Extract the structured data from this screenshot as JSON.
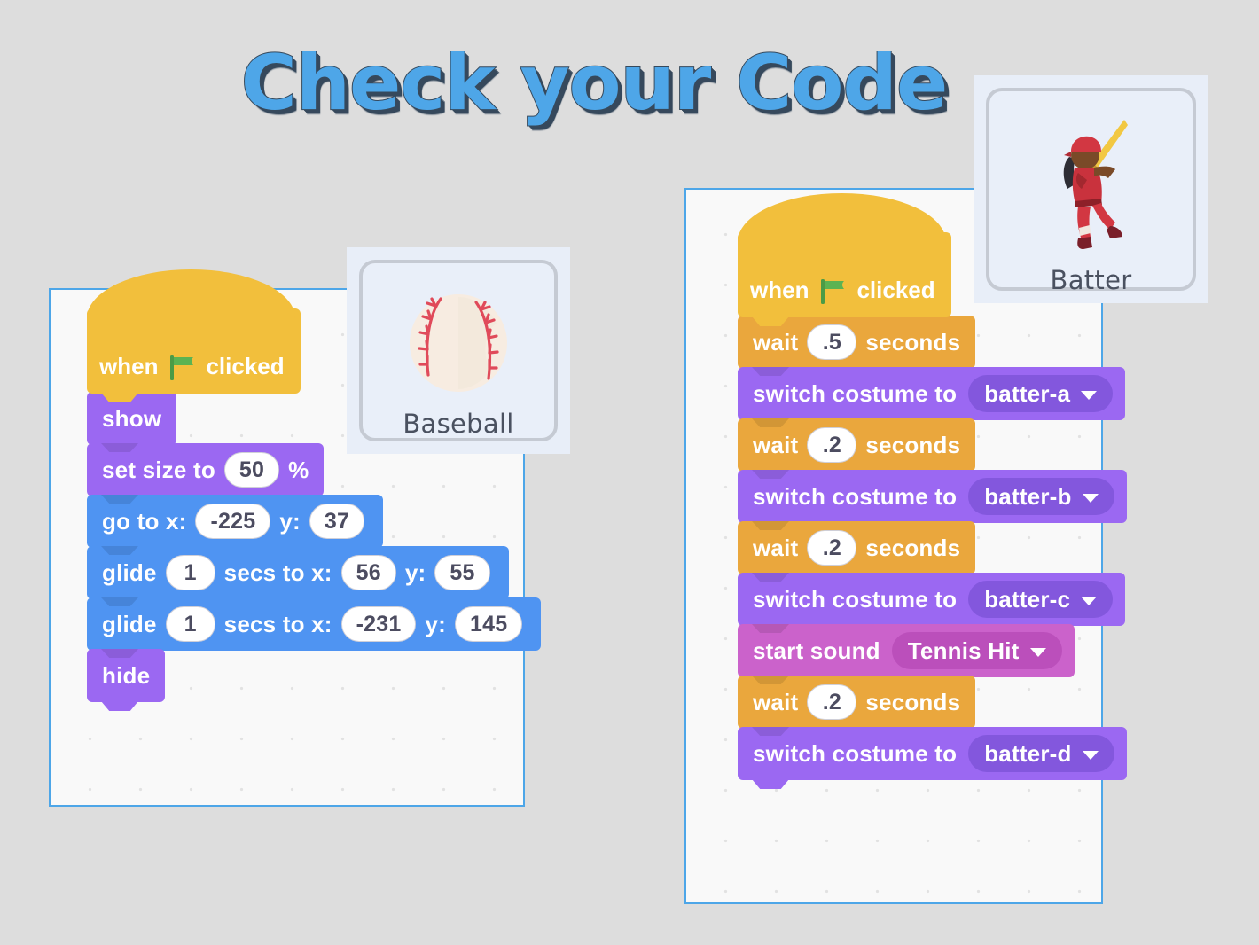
{
  "page": {
    "title": "Check your Code",
    "background_color": "#dddddd",
    "title_color": "#4ea6e8",
    "title_shadow_color": "#36495c"
  },
  "palette_colors": {
    "events": "#f2bf3c",
    "looks": "#9b68f2",
    "motion": "#4f94f2",
    "control": "#eaa73d",
    "sound": "#cb62cb",
    "panel_border": "#4da6e8",
    "panel_background": "#f9f9f9"
  },
  "sprites": [
    {
      "name": "Baseball",
      "icon": "baseball-icon"
    },
    {
      "name": "Batter",
      "icon": "batter-icon"
    }
  ],
  "scripts": [
    {
      "sprite": "Baseball",
      "blocks": [
        {
          "type": "hat",
          "category": "events",
          "words": [
            "when",
            "green-flag-icon",
            "clicked"
          ]
        },
        {
          "type": "stack",
          "category": "looks",
          "label": "show"
        },
        {
          "type": "stack",
          "category": "looks",
          "label_before": "set size to",
          "value": "50",
          "label_after": "%"
        },
        {
          "type": "stack",
          "category": "motion",
          "label_before": "go to x:",
          "value_x": "-225",
          "label_mid": "y:",
          "value_y": "37"
        },
        {
          "type": "stack",
          "category": "motion",
          "label_before": "glide",
          "value_secs": "1",
          "label_mid1": "secs to x:",
          "value_x": "56",
          "label_mid2": "y:",
          "value_y": "55"
        },
        {
          "type": "stack",
          "category": "motion",
          "label_before": "glide",
          "value_secs": "1",
          "label_mid1": "secs to x:",
          "value_x": "-231",
          "label_mid2": "y:",
          "value_y": "145"
        },
        {
          "type": "stack",
          "category": "looks",
          "label": "hide"
        }
      ]
    },
    {
      "sprite": "Batter",
      "blocks": [
        {
          "type": "hat",
          "category": "events",
          "words": [
            "when",
            "green-flag-icon",
            "clicked"
          ]
        },
        {
          "type": "stack",
          "category": "control",
          "label_before": "wait",
          "value": ".5",
          "label_after": "seconds"
        },
        {
          "type": "stack",
          "category": "looks",
          "label_before": "switch costume to",
          "dropdown": "batter-a"
        },
        {
          "type": "stack",
          "category": "control",
          "label_before": "wait",
          "value": ".2",
          "label_after": "seconds"
        },
        {
          "type": "stack",
          "category": "looks",
          "label_before": "switch costume to",
          "dropdown": "batter-b"
        },
        {
          "type": "stack",
          "category": "control",
          "label_before": "wait",
          "value": ".2",
          "label_after": "seconds"
        },
        {
          "type": "stack",
          "category": "looks",
          "label_before": "switch costume to",
          "dropdown": "batter-c"
        },
        {
          "type": "stack",
          "category": "sound",
          "label_before": "start sound",
          "dropdown": "Tennis Hit"
        },
        {
          "type": "stack",
          "category": "control",
          "label_before": "wait",
          "value": ".2",
          "label_after": "seconds"
        },
        {
          "type": "stack",
          "category": "looks",
          "label_before": "switch costume to",
          "dropdown": "batter-d"
        }
      ]
    }
  ],
  "baseball_script": {
    "hat_when": "when",
    "hat_clicked": "clicked",
    "show": "show",
    "set_size_to": "set size to",
    "set_size_value": "50",
    "percent": "%",
    "go_to_x": "go to x:",
    "go_to_x_value": "-225",
    "go_to_y": "y:",
    "go_to_y_value": "37",
    "glide1_label": "glide",
    "glide1_secs": "1",
    "glide1_secs_to_x": "secs to x:",
    "glide1_x": "56",
    "glide1_y_label": "y:",
    "glide1_y": "55",
    "glide2_label": "glide",
    "glide2_secs": "1",
    "glide2_secs_to_x": "secs to x:",
    "glide2_x": "-231",
    "glide2_y_label": "y:",
    "glide2_y": "145",
    "hide": "hide"
  },
  "batter_script": {
    "hat_when": "when",
    "hat_clicked": "clicked",
    "wait1_label": "wait",
    "wait1_value": ".5",
    "wait1_seconds": "seconds",
    "costume1_label": "switch costume to",
    "costume1_value": "batter-a",
    "wait2_label": "wait",
    "wait2_value": ".2",
    "wait2_seconds": "seconds",
    "costume2_label": "switch costume to",
    "costume2_value": "batter-b",
    "wait3_label": "wait",
    "wait3_value": ".2",
    "wait3_seconds": "seconds",
    "costume3_label": "switch costume to",
    "costume3_value": "batter-c",
    "sound_label": "start sound",
    "sound_value": "Tennis Hit",
    "wait4_label": "wait",
    "wait4_value": ".2",
    "wait4_seconds": "seconds",
    "costume4_label": "switch costume to",
    "costume4_value": "batter-d"
  }
}
